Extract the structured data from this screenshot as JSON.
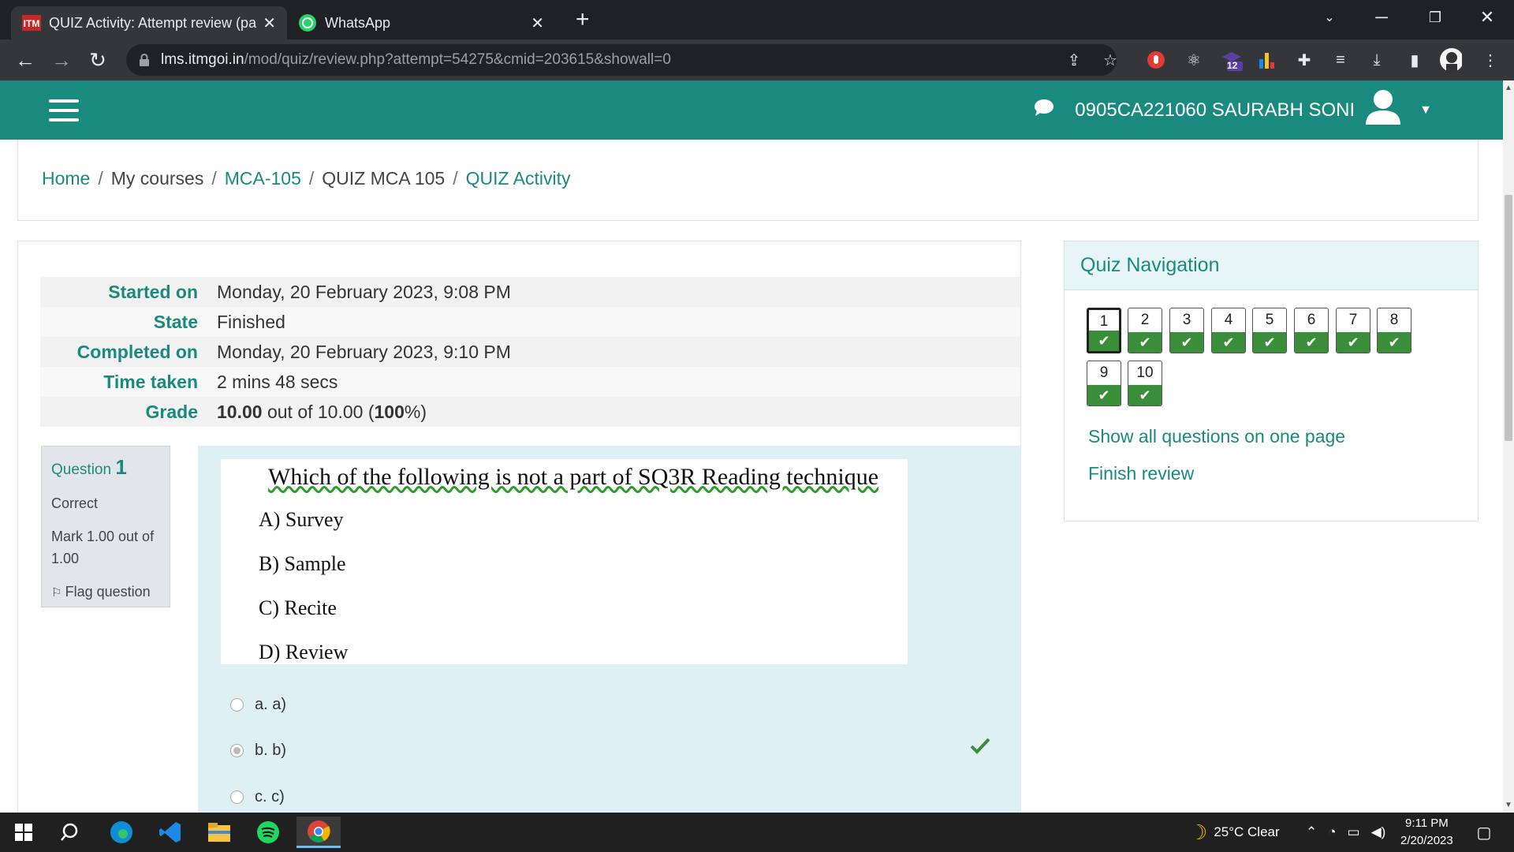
{
  "browser": {
    "tabs": [
      {
        "title": "QUIZ Activity: Attempt review (pa",
        "close": "✕"
      },
      {
        "title": "WhatsApp",
        "close": "✕"
      }
    ],
    "new_tab": "+",
    "url_host": "lms.itmgoi.in",
    "url_path": "/mod/quiz/review.php?attempt=54275&cmid=203615&showall=0",
    "ext_badge": "12"
  },
  "header": {
    "user_name": "0905CA221060 SAURABH SONI"
  },
  "breadcrumb": [
    {
      "label": "Home",
      "link": true
    },
    {
      "label": "My courses",
      "link": false
    },
    {
      "label": "MCA-105",
      "link": true
    },
    {
      "label": "QUIZ MCA 105",
      "link": false
    },
    {
      "label": "QUIZ Activity",
      "link": true
    }
  ],
  "breadcrumb_sep": "/",
  "summary": [
    {
      "key": "Started on",
      "value": "Monday, 20 February 2023, 9:08 PM"
    },
    {
      "key": "State",
      "value": "Finished"
    },
    {
      "key": "Completed on",
      "value": "Monday, 20 February 2023, 9:10 PM"
    },
    {
      "key": "Time taken",
      "value": "2 mins 48 secs"
    },
    {
      "key": "Grade",
      "value_bold": "10.00",
      "value_mid": " out of 10.00 (",
      "value_pct": "100",
      "value_end": "%)"
    }
  ],
  "question": {
    "label": "Question ",
    "number": "1",
    "status": "Correct",
    "mark": "Mark 1.00 out of 1.00",
    "flag": "Flag question",
    "image_title": "Which of the following is not a part of SQ3R Reading technique",
    "image_options": [
      "A)  Survey",
      "B) Sample",
      "C) Recite",
      "D) Review"
    ],
    "answers": [
      {
        "label": "a. a)",
        "checked": false
      },
      {
        "label": "b. b)",
        "checked": true
      },
      {
        "label": "c. c)",
        "checked": false
      }
    ]
  },
  "quiz_nav": {
    "title": "Quiz Navigation",
    "buttons": [
      "1",
      "2",
      "3",
      "4",
      "5",
      "6",
      "7",
      "8",
      "9",
      "10"
    ],
    "show_all": "Show all questions on one page",
    "finish": "Finish review"
  },
  "taskbar": {
    "weather": "25°C  Clear",
    "time": "9:11 PM",
    "date": "2/20/2023"
  },
  "colors": {
    "brand": "#1b8a7e",
    "correct": "#3a8e3a",
    "question_bg": "#dff0f5"
  }
}
